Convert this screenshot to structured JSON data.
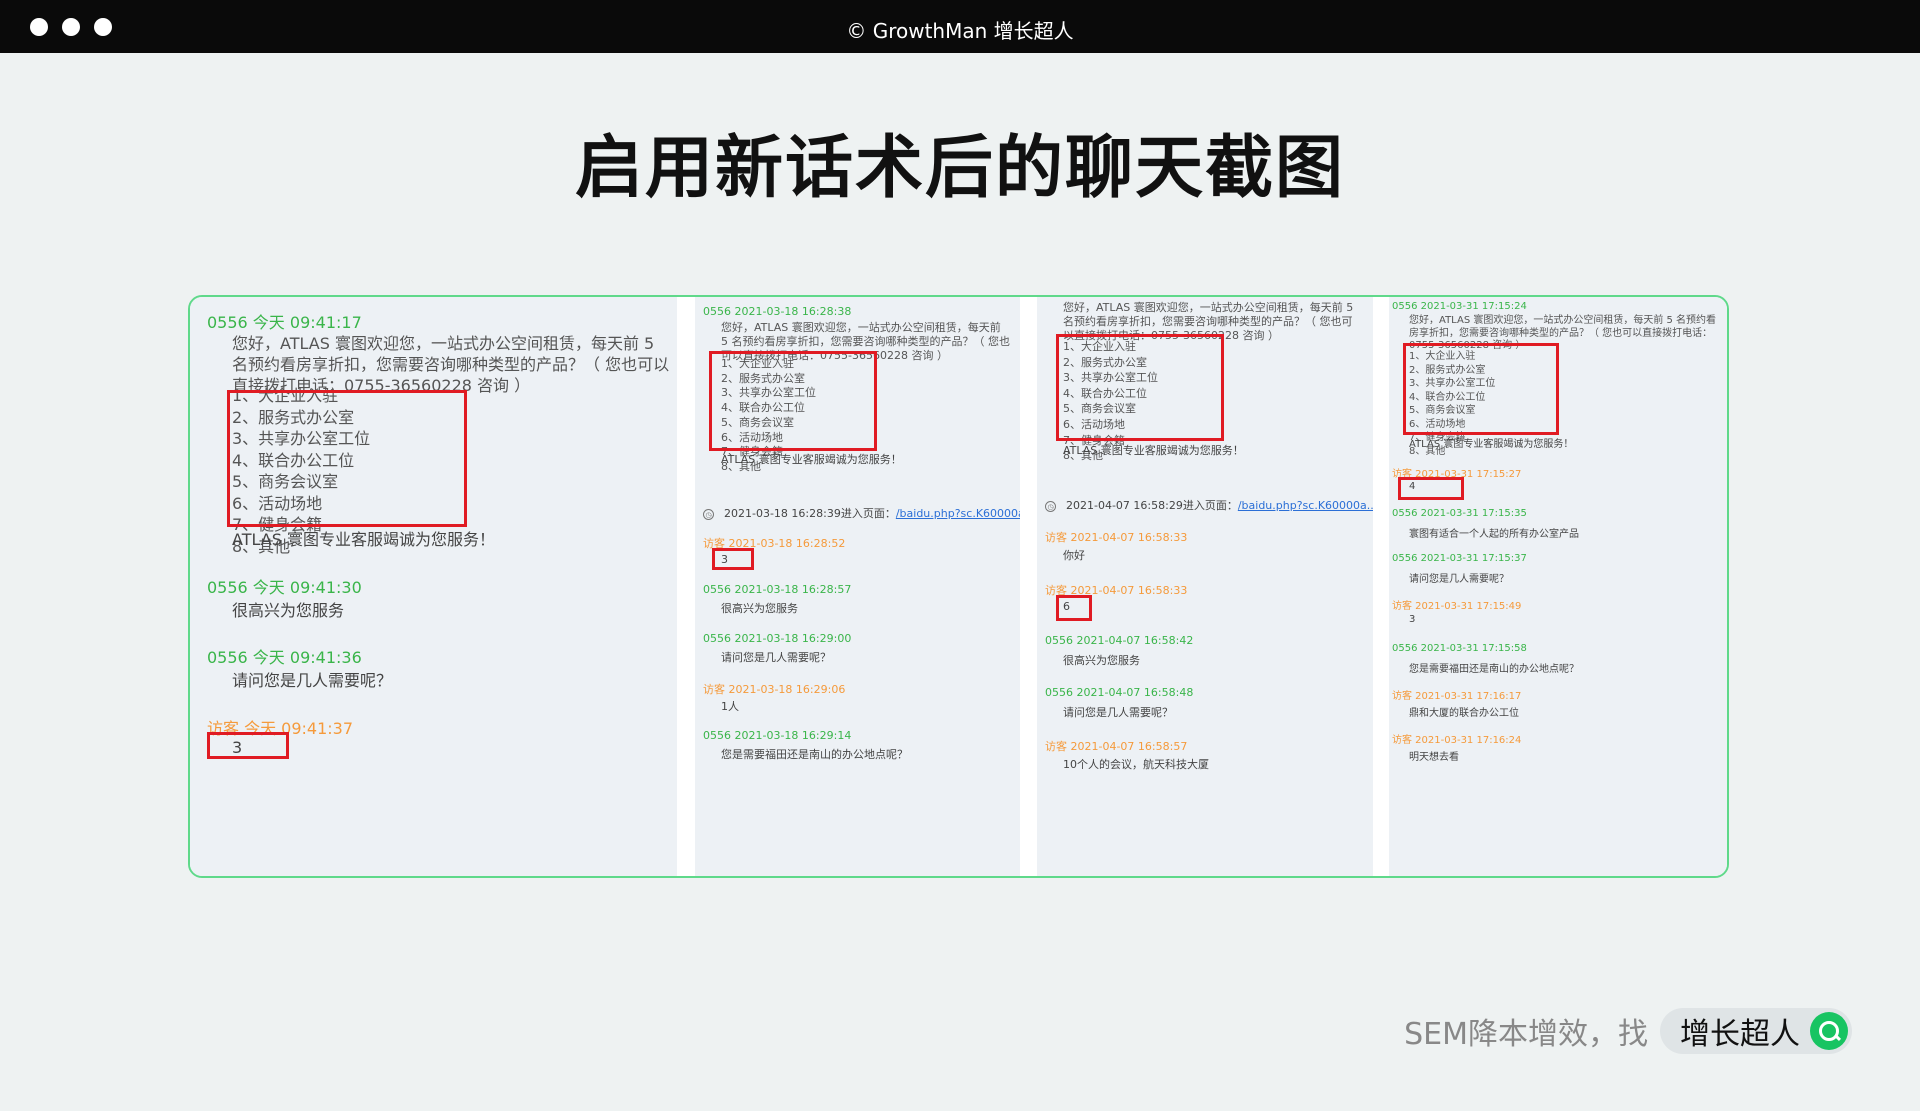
{
  "window": {
    "title": "© GrowthMan 增长超人"
  },
  "page": {
    "title": "启用新话术后的聊天截图"
  },
  "colors": {
    "frame_border": "#5fd98a",
    "agent_green": "#3ab54a",
    "visitor_orange": "#f59a3b",
    "highlight_red": "#e01b23",
    "link_blue": "#2b6fd6"
  },
  "panels": [
    {
      "intro_head": "0556 今天 09:41:17",
      "intro": "您好，ATLAS 寰图欢迎您，一站式办公空间租赁，每天前 5 名预约看房享折扣，您需要咨询哪种类型的产品？（ 您也可以直接拨打电话：0755-36560228 咨询 ）",
      "menu": [
        "1、大企业入驻",
        "2、服务式办公室",
        "3、共享办公室工位",
        "4、联合办公工位",
        "5、商务会议室",
        "6、活动场地",
        "7、健身会籍",
        "8、其他"
      ],
      "closing": "ATLAS 寰图专业客服竭诚为您服务！",
      "messages": [
        {
          "head": "0556 今天 09:41:30",
          "text": "很高兴为您服务"
        },
        {
          "head": "0556 今天 09:41:36",
          "text": "请问您是几人需要呢？"
        },
        {
          "head": "访客 今天 09:41:37",
          "text": "3"
        }
      ]
    },
    {
      "intro_head": "0556 2021-03-18 16:28:38",
      "intro": "您好，ATLAS 寰图欢迎您，一站式办公空间租赁，每天前 5 名预约看房享折扣，您需要咨询哪种类型的产品？（ 您也可以直接拨打电话：0755-36560228 咨询 ）",
      "menu": [
        "1、大企业入驻",
        "2、服务式办公室",
        "3、共享办公室工位",
        "4、联合办公工位",
        "5、商务会议室",
        "6、活动场地",
        "7、健身会籍",
        "8、其他"
      ],
      "closing": "ATLAS 寰图专业客服竭诚为您服务！",
      "visit": {
        "text": "2021-03-18 16:28:39进入页面：",
        "link": "/baidu.php?sc.K60000a..."
      },
      "messages": [
        {
          "head": "访客 2021-03-18 16:28:52",
          "text": "3"
        },
        {
          "head": "0556 2021-03-18 16:28:57",
          "text": "很高兴为您服务"
        },
        {
          "head": "0556 2021-03-18 16:29:00",
          "text": "请问您是几人需要呢？"
        },
        {
          "head": "访客 2021-03-18 16:29:06",
          "text": "1人"
        },
        {
          "head": "0556 2021-03-18 16:29:14",
          "text": "您是需要福田还是南山的办公地点呢？"
        }
      ]
    },
    {
      "intro": "您好，ATLAS 寰图欢迎您，一站式办公空间租赁，每天前 5 名预约看房享折扣，您需要咨询哪种类型的产品？（ 您也可以直接拨打电话：0755-36560228 咨询 ）",
      "menu": [
        "1、大企业入驻",
        "2、服务式办公室",
        "3、共享办公室工位",
        "4、联合办公工位",
        "5、商务会议室",
        "6、活动场地",
        "7、健身会籍",
        "8、其他"
      ],
      "closing": "ATLAS 寰图专业客服竭诚为您服务！",
      "visit": {
        "text": "2021-04-07 16:58:29进入页面：",
        "link": "/baidu.php?sc.K60000a..."
      },
      "messages": [
        {
          "head": "访客 2021-04-07 16:58:33",
          "text": "你好"
        },
        {
          "head": "访客 2021-04-07 16:58:33",
          "text": "6"
        },
        {
          "head": "0556 2021-04-07 16:58:42",
          "text": "很高兴为您服务"
        },
        {
          "head": "0556 2021-04-07 16:58:48",
          "text": "请问您是几人需要呢？"
        },
        {
          "head": "访客 2021-04-07 16:58:57",
          "text": "10个人的会议，航天科技大厦"
        }
      ]
    },
    {
      "intro_head": "0556 2021-03-31 17:15:24",
      "intro": "您好，ATLAS 寰图欢迎您，一站式办公空间租赁，每天前 5 名预约看房享折扣，您需要咨询哪种类型的产品？（ 您也可以直接拨打电话：0755-36560228 咨询 ）",
      "menu": [
        "1、大企业入驻",
        "2、服务式办公室",
        "3、共享办公室工位",
        "4、联合办公工位",
        "5、商务会议室",
        "6、活动场地",
        "7、健身会籍",
        "8、其他"
      ],
      "closing": "ATLAS 寰图专业客服竭诚为您服务！",
      "messages": [
        {
          "head": "访客 2021-03-31 17:15:27",
          "text": "4"
        },
        {
          "head": "0556 2021-03-31 17:15:35",
          "text": "寰图有适合一个人起的所有办公室产品"
        },
        {
          "head": "0556 2021-03-31 17:15:37",
          "text": "请问您是几人需要呢？"
        },
        {
          "head": "访客 2021-03-31 17:15:49",
          "text": "3"
        },
        {
          "head": "0556 2021-03-31 17:15:58",
          "text": "您是需要福田还是南山的办公地点呢？"
        },
        {
          "head": "访客 2021-03-31 17:16:17",
          "text": "鼎和大厦的联合办公工位"
        },
        {
          "head": "访客 2021-03-31 17:16:24",
          "text": "明天想去看"
        }
      ]
    }
  ],
  "footer": {
    "text": "SEM降本增效，找",
    "pill_label": "增长超人",
    "icon": "search-icon"
  }
}
